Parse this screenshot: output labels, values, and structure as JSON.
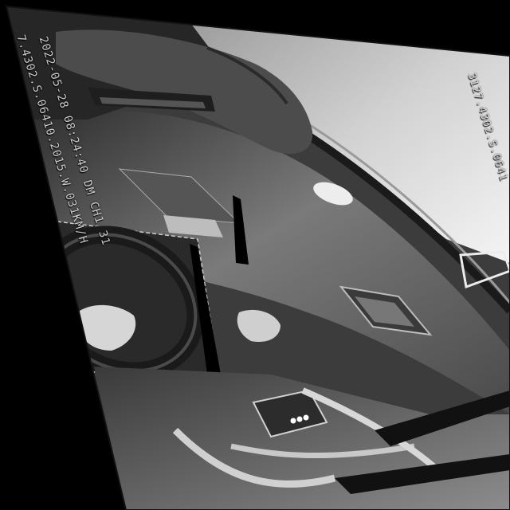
{
  "camera_overlay": {
    "datetime_line": "2022-05-28 08:24:40 DM  CH1 31",
    "gps_line": "7.4302.S.06410.2015.W.031KM/H",
    "right_line": "3127.4302.S.0641"
  },
  "colors": {
    "background": "#000000",
    "sky": "#cfcfcf",
    "dashboard": "#6a6a6a",
    "overlay_text": "#d8d8d8"
  }
}
